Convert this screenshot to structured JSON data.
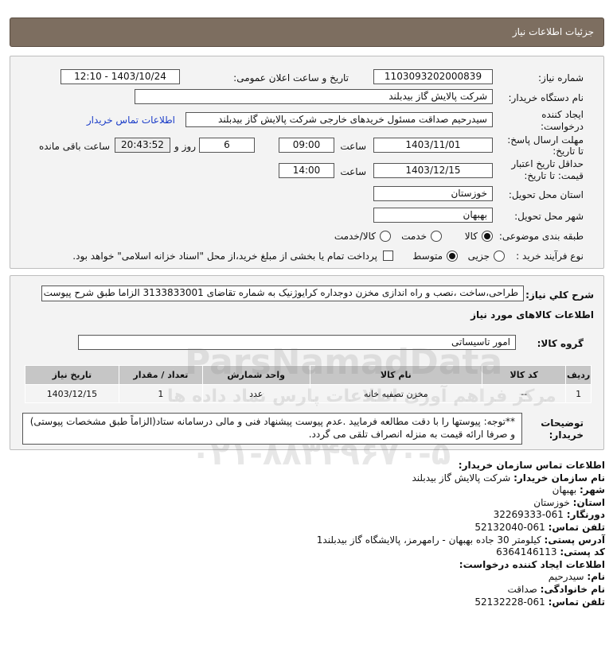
{
  "header": {
    "title": "جزئیات اطلاعات نیاز"
  },
  "form": {
    "need_number_label": "شماره نیاز:",
    "need_number": "1103093202000839",
    "announce_label": "تاریخ و ساعت اعلان عمومی:",
    "announce_value": "1403/10/24 - 12:10",
    "buyer_org_label": "نام دستگاه خریدار:",
    "buyer_org": "شرکت پالایش گاز بیدبلند",
    "creator_label_1": "ایجاد کننده",
    "creator_label_2": "درخواست:",
    "creator": "سیدرحیم صداقت مسئول خریدهای خارجی شرکت پالایش گاز بیدبلند",
    "contact_link": "اطلاعات تماس خریدار",
    "deadline_label_1": "مهلت ارسال پاسخ:",
    "deadline_label_2": "تا تاریخ:",
    "deadline_date": "1403/11/01",
    "time_label": "ساعت",
    "deadline_time": "09:00",
    "days": "6",
    "days_label": "روز و",
    "remaining": "20:43:52",
    "remaining_label": "ساعت باقی مانده",
    "validity_label_1": "حداقل تاریخ اعتبار",
    "validity_label_2": "قیمت: تا تاریخ:",
    "validity_date": "1403/12/15",
    "validity_time": "14:00",
    "province_label": "استان محل تحویل:",
    "province": "خوزستان",
    "city_label": "شهر محل تحویل:",
    "city": "بهبهان",
    "category_label": "طبقه بندی موضوعی:",
    "category_options": [
      "کالا",
      "خدمت",
      "کالا/خدمت"
    ],
    "process_label": "نوع فرآیند خرید :",
    "process_options": [
      "جزیی",
      "متوسط"
    ],
    "payment_note": "پرداخت تمام یا بخشی از مبلغ خرید،از محل \"اسناد خزانه اسلامی\" خواهد بود."
  },
  "details": {
    "summary_label": "شرح کلي نیاز:",
    "summary": "طراحی،ساخت ،نصب و راه اندازی مخزن دوجداره کرایوژنیک به شماره تقاضای 3133833001 الزاما طبق شرح پیوست",
    "goods_info_title": "اطلاعات کالاهای مورد نیاز",
    "group_label": "گروه کالا:",
    "group": "امور تاسیساتی",
    "table_headers": [
      "ردیف",
      "کد کالا",
      "نام کالا",
      "واحد شمارش",
      "تعداد / مقدار",
      "تاریخ نیاز"
    ],
    "rows": [
      [
        "1",
        "--",
        "مخزن تصفیه خانه",
        "عدد",
        "1",
        "1403/12/15"
      ]
    ],
    "buyer_notes_label_1": "توضیحات",
    "buyer_notes_label_2": "خریدار:",
    "buyer_notes": "**توجه: پیوستها را با دقت مطالعه فرمایید .عدم پیوست پیشنهاد فنی و مالی درسامانه ستاد(الزاماً طبق مشخصات پیوستی) و صرفا ارائه قیمت به منزله انصراف تلقی می گردد."
  },
  "contact": {
    "title": "اطلاعات تماس سازمان خریدار:",
    "org_label": "نام سازمان خریدار:",
    "org": "شرکت پالایش گاز بیدبلند",
    "city_label": "شهر:",
    "city": "بهبهان",
    "province_label": "استان:",
    "province": "خوزستان",
    "fax_label": "دورنگار:",
    "fax": "061-32269333",
    "phone_label": "تلفن تماس:",
    "phone": "061-52132040",
    "address_label": "آدرس پستی:",
    "address": "کیلومتر 30 جاده بهبهان - رامهرمز، پالایشگاه گاز بیدبلند1",
    "postal_label": "کد پستی:",
    "postal": "6364146113",
    "creator_title": "اطلاعات ایجاد کننده درخواست:",
    "name_label": "نام:",
    "name": "سیدرحیم",
    "family_label": "نام خانوادگی:",
    "family": "صداقت",
    "creator_phone_label": "تلفن تماس:",
    "creator_phone": "061-52132228"
  },
  "watermark": {
    "line1": "ParsNamadData",
    "line2": "مرکز فراهم آوری اطلاعات پارس نماد داده ها",
    "line3": "۰۲۱-۸۸۳۴۹۶۷۰-۵"
  }
}
